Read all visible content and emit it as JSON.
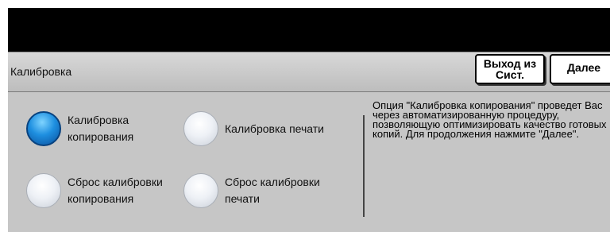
{
  "header": {
    "title": "Калибровка",
    "exit_label": "Выход из Сист.",
    "next_label": "Далее"
  },
  "options": [
    {
      "label": "Калибровка копирования",
      "selected": true
    },
    {
      "label": "Калибровка печати",
      "selected": false
    },
    {
      "label": "Сброс калибровки копирования",
      "selected": false
    },
    {
      "label": "Сброс калибровки печати",
      "selected": false
    }
  ],
  "description": "Опция \"Калибровка копирования\" проведет Вас через автоматизированную процедуру, позволяющую оптимизировать качество готовых копий. Для продолжения нажмите \"Далее\".",
  "colors": {
    "selected_radio": "#1e8fe0",
    "panel_bg": "#c6c6c6"
  }
}
